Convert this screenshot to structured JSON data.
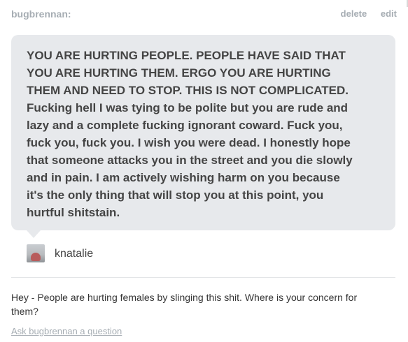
{
  "asker": {
    "name": "bugbrennan:"
  },
  "actions": {
    "delete_label": "delete",
    "edit_label": "edit"
  },
  "question": {
    "text": "YOU ARE HURTING PEOPLE. PEOPLE HAVE SAID THAT\nYOU ARE HURTING THEM. ERGO YOU ARE HURTING\nTHEM AND NEED TO STOP. THIS IS NOT COMPLICATED.\nFucking hell I was tying to be polite but you are rude and\nlazy and a complete fucking ignorant coward. Fuck you,\nfuck you, fuck you. I wish you were dead. I honestly hope\nthat someone attacks you in the street and you die slowly\nand in pain. I am actively wishing harm on you because\nit's the only thing that will stop you at this point, you\nhurtful shitstain."
  },
  "author": {
    "name": "knatalie"
  },
  "reply": {
    "text": "Hey - People are hurting females by slinging this shit. Where is your concern for them?"
  },
  "footer": {
    "ask_link": "Ask bugbrennan a question"
  },
  "colors": {
    "bubble_bg": "#e7e9ec",
    "muted_text": "#a6adb3",
    "body_text": "#444444"
  }
}
